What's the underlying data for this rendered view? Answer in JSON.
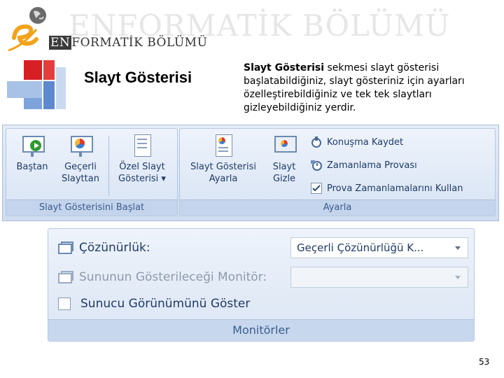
{
  "header": {
    "watermark": "ENFORMATİK BÖLÜMÜ",
    "brand_prefix": "EN",
    "brand_rest": "FORMATİK BÖLÜMÜ"
  },
  "slide": {
    "title": "Slayt Gösterisi",
    "description_bold": "Slayt Gösterisi",
    "description_rest": " sekmesi slayt gösterisi başlatabildiğiniz, slayt gösteriniz için ayarları özelleştirebildiğiniz ve tek tek slaytları gizleyebildiğiniz yerdir.",
    "page_number": "53"
  },
  "ribbon": {
    "group1": {
      "label": "Slayt Gösterisini Başlat",
      "buttons": [
        {
          "line1": "Baştan",
          "line2": "",
          "icon": "play-slideshow-icon"
        },
        {
          "line1": "Geçerli",
          "line2": "Slayttan",
          "icon": "current-slide-icon"
        },
        {
          "line1": "Özel Slayt",
          "line2": "Gösterisi ▾",
          "icon": "custom-show-icon"
        }
      ]
    },
    "group2": {
      "label": "Ayarla",
      "buttons": [
        {
          "line1": "Slayt Gösterisi",
          "line2": "Ayarla",
          "icon": "setup-show-icon"
        },
        {
          "line1": "Slayt",
          "line2": "Gizle",
          "icon": "hide-slide-icon"
        }
      ],
      "small_buttons": [
        {
          "label": "Konuşma Kaydet",
          "icon": "record-narration-icon"
        },
        {
          "label": "Zamanlama Provası",
          "icon": "rehearse-timings-icon"
        },
        {
          "label": "Prova Zamanlamalarını Kullan",
          "icon": "checkbox-checked-icon",
          "checked": true
        }
      ]
    }
  },
  "monitors": {
    "label": "Monitörler",
    "resolution_label": "Çözünürlük:",
    "resolution_value": "Geçerli Çözünürlüğü K...",
    "monitor_label": "Sununun Gösterileceği Monitör:",
    "monitor_value": "",
    "presenter_view_label": "Sunucu Görünümünü Göster",
    "presenter_view_checked": false
  },
  "colors": {
    "accent_red": "#d71f26",
    "accent_blue": "#5f89cf",
    "ribbon_text": "#1f3b66"
  }
}
